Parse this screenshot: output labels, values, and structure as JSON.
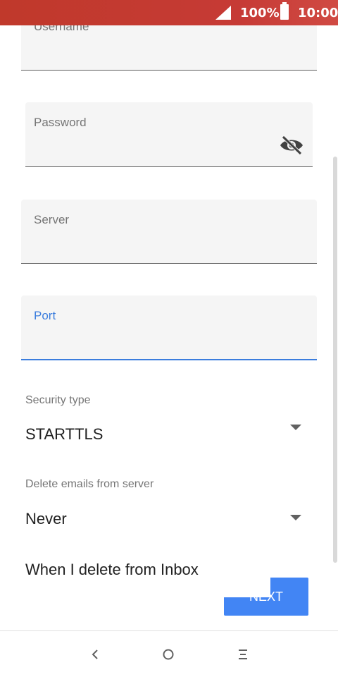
{
  "status_bar": {
    "battery": "100%",
    "time": "10:00"
  },
  "form": {
    "username_label": "Username",
    "password_label": "Password",
    "server_label": "Server",
    "port_label": "Port",
    "security_type_label": "Security type",
    "security_type_value": "STARTTLS",
    "delete_emails_label": "Delete emails from server",
    "delete_emails_value": "Never",
    "when_delete_label": "When I delete from Inbox",
    "next_label": "NEXT"
  },
  "colors": {
    "status_bar": "#c0392b",
    "accent": "#3b7ddd",
    "button": "#4285f4"
  },
  "icons": [
    "signal-icon",
    "battery-icon",
    "visibility-off-icon",
    "dropdown-arrow-icon",
    "back-icon",
    "home-icon",
    "menu-icon"
  ]
}
